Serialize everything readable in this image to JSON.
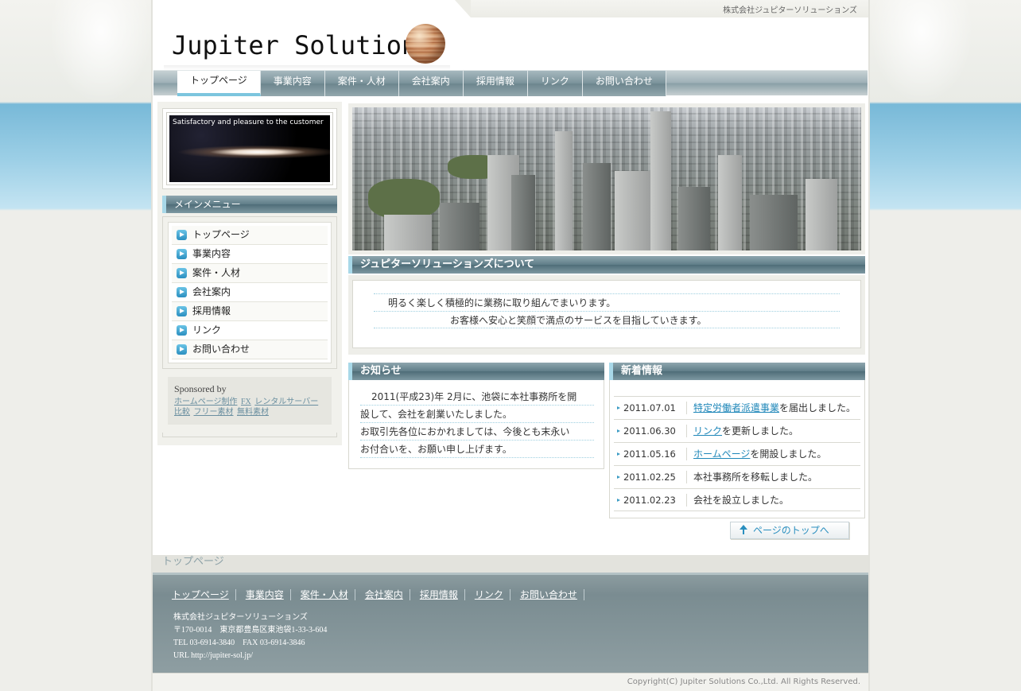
{
  "header": {
    "company_name": "株式会社ジュピターソリューションズ",
    "logo_text": "Jupiter Solutions"
  },
  "nav": {
    "items": [
      "トップページ",
      "事業内容",
      "案件・人材",
      "会社案内",
      "採用情報",
      "リンク",
      "お問い合わせ"
    ],
    "active_index": 0
  },
  "sidebar": {
    "banner_caption": "Satisfactory and pleasure to the customer",
    "menu_title": "メインメニュー",
    "menu_items": [
      "トップページ",
      "事業内容",
      "案件・人材",
      "会社案内",
      "採用情報",
      "リンク",
      "お問い合わせ"
    ],
    "sponsor": {
      "title": "Sponsored by",
      "links": [
        "ホームページ制作",
        "FX",
        "レンタルサーバー比較",
        "フリー素材",
        "無料素材"
      ]
    }
  },
  "about": {
    "title": "ジュピターソリューションズについて",
    "lines": [
      "明るく楽しく積極的に業務に取り組んでまいります。",
      "お客様へ安心と笑顔で満点のサービスを目指していきます。"
    ]
  },
  "news": {
    "title": "お知らせ",
    "lines": [
      "2011(平成23)年 2月に、池袋に本社事務所を開",
      "設して、会社を創業いたしました。",
      "お取引先各位におかれましては、今後とも末永い",
      "お付合いを、お願い申し上げます。"
    ]
  },
  "whats_new": {
    "title": "新着情報",
    "items": [
      {
        "date": "2011.07.01",
        "link": "特定労働者派遣事業",
        "text": "を届出しました。"
      },
      {
        "date": "2011.06.30",
        "link": "リンク",
        "text": "を更新しました。"
      },
      {
        "date": "2011.05.16",
        "link": "ホームページ",
        "text": "を開設しました。"
      },
      {
        "date": "2011.02.25",
        "link": "",
        "text": "本社事務所を移転しました。"
      },
      {
        "date": "2011.02.23",
        "link": "",
        "text": "会社を設立しました。"
      }
    ]
  },
  "to_top_label": "ページのトップへ",
  "breadcrumb": "トップページ",
  "footer": {
    "nav": [
      "トップページ",
      "事業内容",
      "案件・人材",
      "会社案内",
      "採用情報",
      "リンク",
      "お問い合わせ"
    ],
    "company": "株式会社ジュピターソリューションズ",
    "address": "〒170-0014　東京都豊島区東池袋1-33-3-604",
    "tel": "TEL 03-6914-3840　FAX 03-6914-3846",
    "url": "URL http://jupiter-sol.jp/",
    "copyright": "Copyright(C) Jupiter Solutions Co.,Ltd. All Rights Reserved."
  },
  "colors": {
    "accent": "#7cc5de",
    "link": "#1f87b9",
    "heading_bg": "#5f7d88"
  }
}
